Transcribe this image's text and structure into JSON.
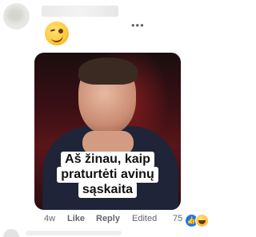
{
  "comment": {
    "meme_caption": [
      "Aš žinau, kaip",
      "praturtėti avinų",
      "sąskaita"
    ],
    "more_icon": "more-horizontal-icon"
  },
  "actions": {
    "time": "4w",
    "like": "Like",
    "reply": "Reply",
    "edited": "Edited",
    "reaction_count": "75",
    "reactions": [
      "like-reaction-icon",
      "haha-reaction-icon"
    ]
  },
  "colors": {
    "like_blue": "#1877f2",
    "meta_text": "#65676b"
  }
}
